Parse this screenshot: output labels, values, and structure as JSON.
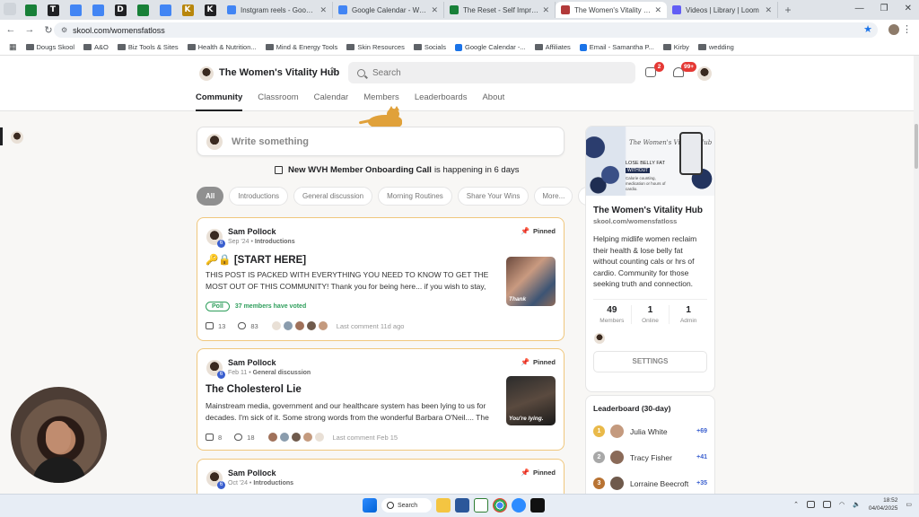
{
  "browser": {
    "pinned_tabs": [
      {
        "letter": "",
        "color": "#188038"
      },
      {
        "letter": "T",
        "color": "#202124"
      },
      {
        "letter": "",
        "color": "#4285f4"
      },
      {
        "letter": "",
        "color": "#4285f4"
      },
      {
        "letter": "D",
        "color": "#202124"
      },
      {
        "letter": "",
        "color": "#188038"
      },
      {
        "letter": "",
        "color": "#4285f4"
      },
      {
        "letter": "K",
        "color": "#b8860b"
      },
      {
        "letter": "K",
        "color": "#202124"
      }
    ],
    "tabs": [
      {
        "title": "Instgram reels - Google Docs",
        "color": "#4285f4",
        "active": false
      },
      {
        "title": "Google Calendar - Week of Ma",
        "color": "#4285f4",
        "active": false
      },
      {
        "title": "The Reset - Self Improvement",
        "color": "#188038",
        "active": false
      },
      {
        "title": "The Women's Vitality Hub",
        "color": "#b23a3a",
        "active": true
      },
      {
        "title": "Videos | Library | Loom",
        "color": "#625df5",
        "active": false
      }
    ],
    "url": "skool.com/womensfatloss",
    "bookmarks": [
      "Dougs Skool",
      "A&O",
      "Biz Tools & Sites",
      "Health & Nutrition...",
      "Mind & Energy Tools",
      "Skin Resources",
      "Socials",
      "Google Calendar -...",
      "Affiliates",
      "Email - Samantha P...",
      "Kirby",
      "wedding"
    ]
  },
  "header": {
    "community_name": "The Women's Vitality Hub",
    "search_placeholder": "Search",
    "chat_badge": "2",
    "notif_badge": "99+",
    "nav": [
      "Community",
      "Classroom",
      "Calendar",
      "Members",
      "Leaderboards",
      "About"
    ]
  },
  "composer": {
    "placeholder": "Write something"
  },
  "event": {
    "title": "New WVH Member Onboarding Call",
    "suffix": "is happening in 6 days"
  },
  "filters": [
    "All",
    "Introductions",
    "General discussion",
    "Morning Routines",
    "Share Your Wins",
    "More..."
  ],
  "posts": [
    {
      "author": "Sam Pollock",
      "level": "6",
      "date": "Sep '24",
      "category": "Introductions",
      "pinned": "Pinned",
      "title": "🔑🔒 [START HERE]",
      "body": "THIS POST IS PACKED WITH EVERYTHING YOU NEED TO KNOW TO GET THE MOST OUT OF THIS COMMUNITY! Thank you for being here... if you wish to stay, don't mess",
      "poll_label": "Poll",
      "poll_votes": "37 members have voted",
      "likes": "13",
      "comments": "83",
      "last_comment": "Last comment 11d ago",
      "thumb_text": "Thank"
    },
    {
      "author": "Sam Pollock",
      "level": "6",
      "date": "Feb 11",
      "category": "General discussion",
      "pinned": "Pinned",
      "title": "The Cholesterol Lie",
      "body": "Mainstream media, government and our healthcare system has been lying to us for decades. I'm sick of it. Some strong words from the wonderful Barbara O'Neil.... The",
      "likes": "8",
      "comments": "18",
      "last_comment": "Last comment Feb 15",
      "thumb_text": "You're lying."
    },
    {
      "author": "Sam Pollock",
      "level": "6",
      "date": "Oct '24",
      "category": "Introductions",
      "pinned": "Pinned"
    }
  ],
  "sidebar": {
    "cover_script": "The Women's Vitality Hub",
    "cover_line1": "LOSE BELLY FAT",
    "cover_line2": "WITHOUT",
    "cover_line3": "Calorie counting, medication or hours of cardio.",
    "name": "The Women's Vitality Hub",
    "url": "skool.com/womensfatloss",
    "description": "Helping midlife women reclaim their health & lose belly fat without counting cals or hrs of cardio. Community for those seeking truth and connection.",
    "stats": [
      {
        "value": "49",
        "label": "Members"
      },
      {
        "value": "1",
        "label": "Online"
      },
      {
        "value": "1",
        "label": "Admin"
      }
    ],
    "settings_label": "SETTINGS"
  },
  "leaderboard": {
    "title": "Leaderboard (30-day)",
    "rows": [
      {
        "rank": "1",
        "name": "Julia White",
        "points": "+69",
        "rank_color": "#e9b949"
      },
      {
        "rank": "2",
        "name": "Tracy Fisher",
        "points": "+41",
        "rank_color": "#a8a8a8"
      },
      {
        "rank": "3",
        "name": "Lorraine Beecroft",
        "points": "+35",
        "rank_color": "#b87333"
      }
    ]
  },
  "taskbar": {
    "search_label": "Search",
    "time": "18:52",
    "date": "04/04/2025"
  }
}
